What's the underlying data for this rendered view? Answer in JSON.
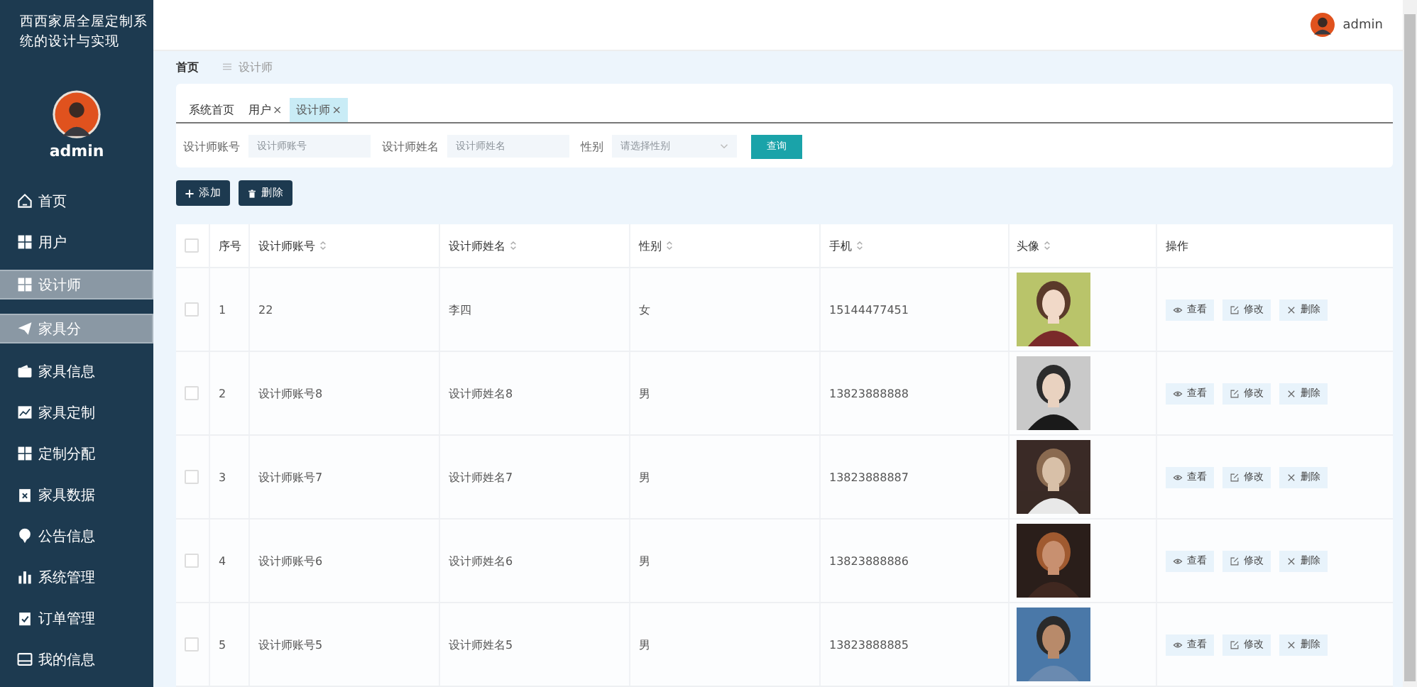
{
  "sidebar": {
    "title": "西西家居全屋定制系统的设计与实现",
    "username": "admin",
    "items": [
      {
        "label": "首页",
        "highlighted": false
      },
      {
        "label": "用户",
        "highlighted": false
      },
      {
        "label": "设计师",
        "highlighted": true
      },
      {
        "label": "家具分",
        "highlighted": true
      },
      {
        "label": "家具信息",
        "highlighted": false
      },
      {
        "label": "家具定制",
        "highlighted": false
      },
      {
        "label": "定制分配",
        "highlighted": false
      },
      {
        "label": "家具数据",
        "highlighted": false
      },
      {
        "label": "公告信息",
        "highlighted": false
      },
      {
        "label": "系统管理",
        "highlighted": false
      },
      {
        "label": "订单管理",
        "highlighted": false
      },
      {
        "label": "我的信息",
        "highlighted": false
      }
    ]
  },
  "topbar": {
    "username": "admin"
  },
  "breadcrumb": [
    "首页",
    "设计师"
  ],
  "tabs": [
    {
      "label": "系统首页",
      "closable": false,
      "selected": false
    },
    {
      "label": "用户",
      "closable": true,
      "selected": false
    },
    {
      "label": "设计师",
      "closable": true,
      "selected": true
    }
  ],
  "close_glyph": "×",
  "filters": [
    {
      "label": "设计师账号",
      "placeholder": "设计师账号",
      "kind": "text"
    },
    {
      "label": "设计师姓名",
      "placeholder": "设计师姓名",
      "kind": "text"
    },
    {
      "label": "性别",
      "placeholder": "请选择性别",
      "kind": "select"
    }
  ],
  "search_button": "查询",
  "actions": [
    "添加",
    "删除"
  ],
  "table": {
    "select_all_checked": false,
    "columns": [
      {
        "label": "序号",
        "sortable": false
      },
      {
        "label": "设计师账号",
        "sortable": true
      },
      {
        "label": "设计师姓名",
        "sortable": true
      },
      {
        "label": "性别",
        "sortable": true
      },
      {
        "label": "手机",
        "sortable": true
      },
      {
        "label": "头像",
        "sortable": true
      },
      {
        "label": "操作",
        "sortable": false
      }
    ],
    "rows": [
      {
        "checked": false,
        "cells": [
          "1",
          "22",
          "李四",
          "女",
          "15144477451"
        ],
        "actions": [
          "查看",
          "修改",
          "删除"
        ]
      },
      {
        "checked": false,
        "cells": [
          "2",
          "设计师账号8",
          "设计师姓名8",
          "男",
          "13823888888"
        ],
        "actions": [
          "查看",
          "修改",
          "删除"
        ]
      },
      {
        "checked": false,
        "cells": [
          "3",
          "设计师账号7",
          "设计师姓名7",
          "男",
          "13823888887"
        ],
        "actions": [
          "查看",
          "修改",
          "删除"
        ]
      },
      {
        "checked": false,
        "cells": [
          "4",
          "设计师账号6",
          "设计师姓名6",
          "男",
          "13823888886"
        ],
        "actions": [
          "查看",
          "修改",
          "删除"
        ]
      },
      {
        "checked": false,
        "cells": [
          "5",
          "设计师账号5",
          "设计师姓名5",
          "男",
          "13823888885"
        ],
        "actions": [
          "查看",
          "修改",
          "删除"
        ]
      }
    ]
  }
}
